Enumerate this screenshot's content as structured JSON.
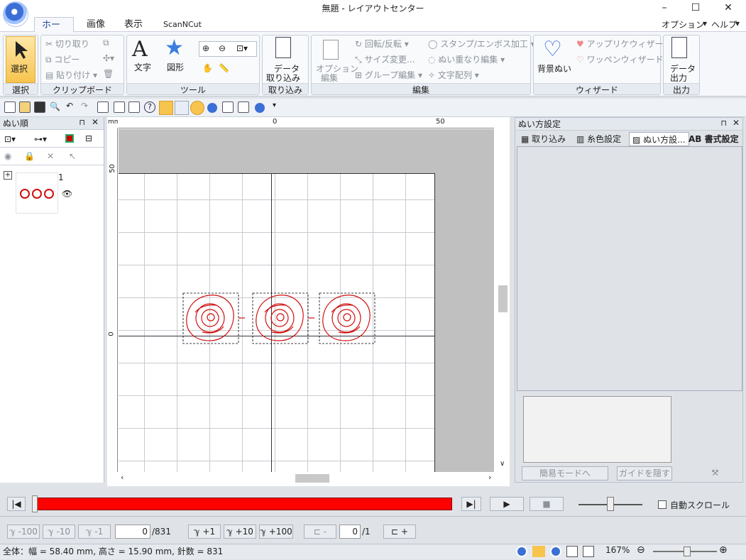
{
  "window": {
    "title": "無題 - レイアウトセンター",
    "min": "–",
    "max": "☐",
    "close": "✕"
  },
  "menu": {
    "tabs": [
      "ホーム",
      "画像",
      "表示",
      "ScanNCut"
    ],
    "options": "オプション",
    "options_arrow": "▾",
    "help": "ヘルプ",
    "help_arrow": "▾"
  },
  "ribbon": {
    "select": {
      "label": "選択",
      "group": "選択"
    },
    "clipboard": {
      "cut": "切り取り",
      "copy": "コピー",
      "paste": "貼り付け",
      "group": "クリップボード"
    },
    "tools": {
      "text": "文字",
      "shape": "図形",
      "group": "ツール"
    },
    "import": {
      "label1": "データ",
      "label2": "取り込み",
      "group": "取り込み"
    },
    "edit": {
      "option1": "オプション",
      "option2": "編集",
      "rotate": "回転/反転",
      "resize": "サイズ変更...",
      "group_edit": "グループ編集",
      "stamp": "スタンプ/エンボス加工",
      "overlap": "ぬい重なり編集",
      "text_arrange": "文字配列",
      "group": "編集"
    },
    "wizard": {
      "bg1": "背景ぬい",
      "applique": "アップリケウィザード",
      "patch": "ワッペンウィザード",
      "group": "ウィザード"
    },
    "output": {
      "label1": "データ",
      "label2": "出力",
      "group": "出力"
    }
  },
  "left_panel": {
    "title": "ぬい順",
    "item_number": "1"
  },
  "ruler": {
    "unit": "mm",
    "h_labels": [
      "0",
      "50"
    ],
    "v_labels": [
      "50",
      "0"
    ]
  },
  "right_panel": {
    "title": "ぬい方設定",
    "tabs": [
      "取り込み",
      "糸色設定",
      "ぬい方設...",
      "AB 書式設定"
    ],
    "simple_mode": "簡易モードへ",
    "hide_guide": "ガイドを隠す"
  },
  "playback": {
    "auto_scroll": "自動スクロール"
  },
  "stepper": {
    "m100": "-100",
    "m10": "-10",
    "m1": "-1",
    "current": "0",
    "total": "/831",
    "p1": "+1",
    "p10": "+10",
    "p100": "+100",
    "minus": "-",
    "obj_current": "0",
    "obj_total": "/1",
    "plus": "+"
  },
  "status": {
    "text": "全体：幅 = 58.40 mm, 高さ = 15.90 mm, 針数 = 831",
    "zoom": "167%"
  },
  "colors": {
    "thread": "#d01010",
    "accent": "#234a9a"
  }
}
